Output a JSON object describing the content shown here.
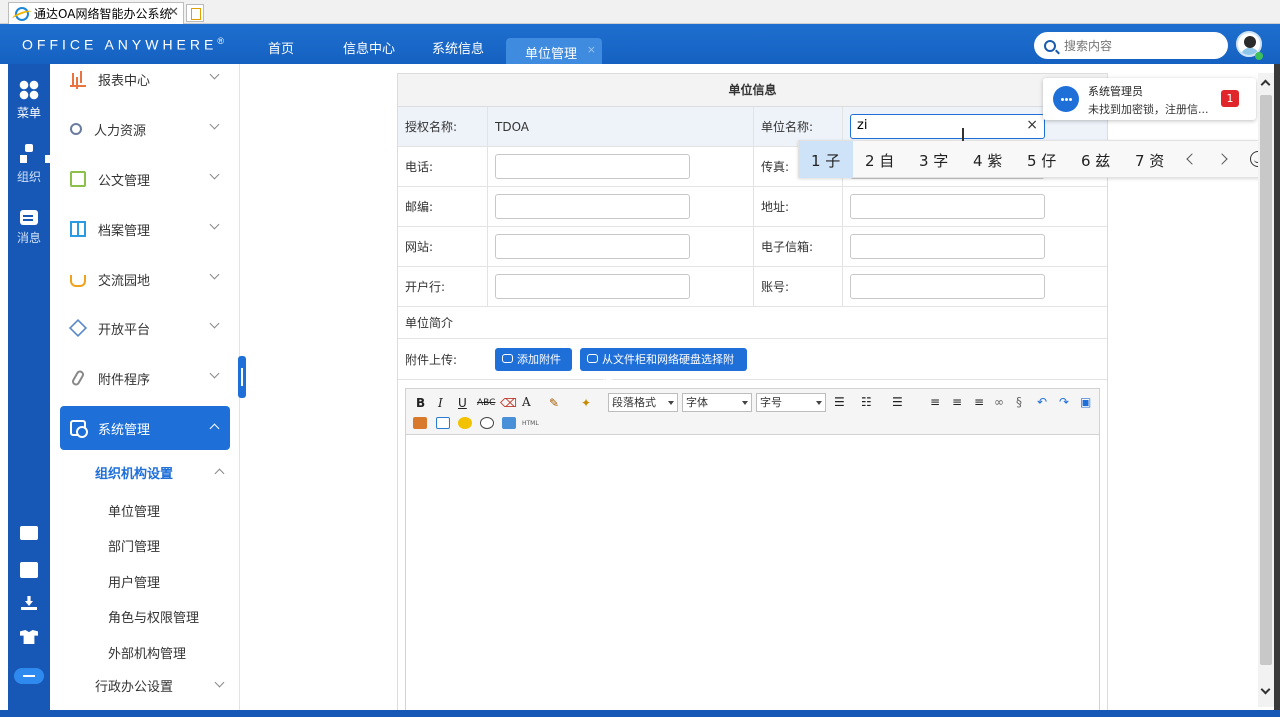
{
  "browser": {
    "tab_title": "通达OA网络智能办公系统",
    "tab_close": "✕"
  },
  "header": {
    "logo": "Office Anywhere",
    "logo_mark": "®",
    "nav": [
      "首页",
      "信息中心",
      "系统信息"
    ],
    "active_tab": "单位管理",
    "active_tab_close": "×",
    "search_placeholder": "搜索内容"
  },
  "rail": {
    "menu": "菜单",
    "org": "组织",
    "msg": "消息"
  },
  "sidebar": {
    "items": [
      "报表中心",
      "人力资源",
      "公文管理",
      "档案管理",
      "交流园地",
      "开放平台",
      "附件程序",
      "系统管理"
    ],
    "sub_group": "组织机构设置",
    "sub_items": [
      "单位管理",
      "部门管理",
      "用户管理",
      "角色与权限管理",
      "外部机构管理"
    ],
    "sub_group2": "行政办公设置"
  },
  "form": {
    "title": "单位信息",
    "auth_label": "授权名称:",
    "auth_value": "TDOA",
    "unit_label": "单位名称:",
    "unit_value": "zi",
    "unit_clear": "×",
    "phone_label": "电话:",
    "fax_label": "传真:",
    "zip_label": "邮编:",
    "addr_label": "地址:",
    "web_label": "网站:",
    "email_label": "电子信箱:",
    "bank_label": "开户行:",
    "account_label": "账号:",
    "intro_label": "单位简介",
    "upload_label": "附件上传:",
    "btn_add": "添加附件",
    "btn_pick": "从文件柜和网络硬盘选择附件"
  },
  "editor": {
    "bold": "B",
    "italic": "I",
    "underline": "U",
    "strike": "ABC",
    "font_color": "A",
    "paragraph": "段落格式",
    "font": "字体",
    "size": "字号",
    "html": "HTML"
  },
  "popup": {
    "title": "系统管理员",
    "body": "未找到加密锁，注册信...",
    "badge": "1"
  },
  "ime": {
    "candidates": [
      "1 子",
      "2 自",
      "3 字",
      "4 紫",
      "5 仔",
      "6 兹",
      "7 资"
    ]
  },
  "colors": {
    "primary": "#1f6fd9",
    "header": "#1561c2",
    "rail": "#1758b6",
    "badge": "#e0262a"
  }
}
